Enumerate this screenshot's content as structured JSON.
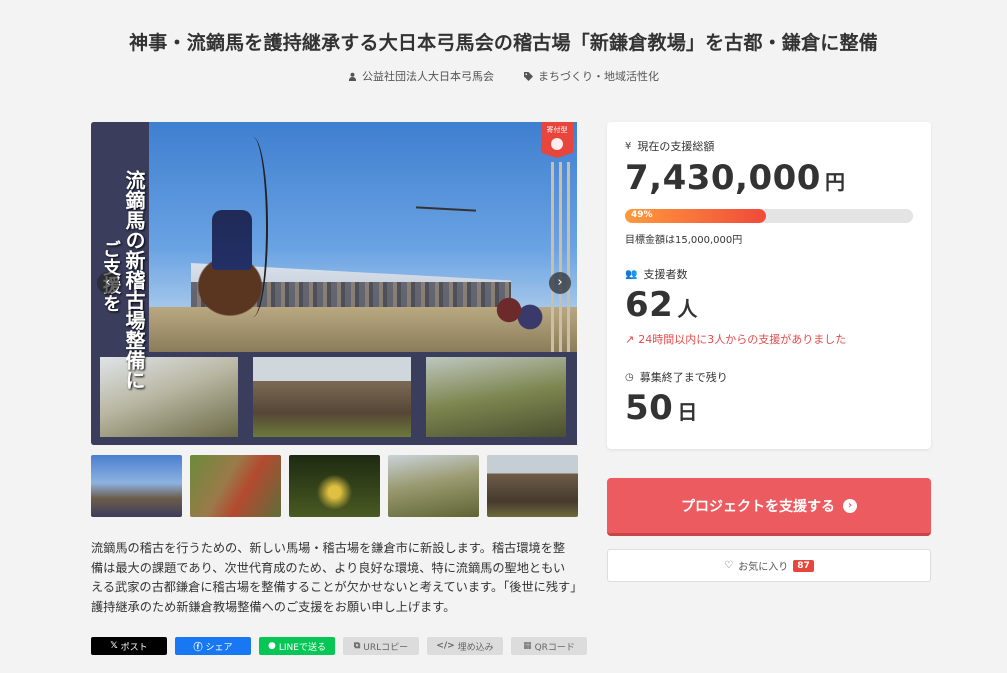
{
  "project": {
    "title": "神事・流鏑馬を護持継承する大日本弓馬会の稽古場「新鎌倉教場」を古都・鎌倉に整備",
    "owner": "公益社団法人大日本弓馬会",
    "category": "まちづくり・地域活性化"
  },
  "hero": {
    "vertical_text_1": "流鏑馬の新稽古場整備に",
    "vertical_text_2": "ご支援を",
    "badge_label": "寄付型",
    "thumbnails": [
      "thumb-1",
      "thumb-2",
      "thumb-3",
      "thumb-4",
      "thumb-5"
    ]
  },
  "description": "流鏑馬の稽古を行うための、新しい馬場・稽古場を鎌倉市に新設します。稽古環境を整備は最大の課題であり、次世代育成のため、より良好な環境、特に流鏑馬の聖地ともいえる武家の古都鎌倉に稽古場を整備することが欠かせないと考えています。「後世に残す」護持継承のため新鎌倉教場整備へのご支援をお願い申し上げます。",
  "share": {
    "x": "ポスト",
    "facebook": "シェア",
    "line": "LINEで送る",
    "url_copy": "URLコピー",
    "embed": "埋め込み",
    "qr": "QRコード"
  },
  "stats": {
    "total_label": "現在の支援総額",
    "total_amount": "7,430,000",
    "total_unit": "円",
    "progress_label": "49%",
    "progress_fraction": 0.49,
    "goal_text": "目標金額は15,000,000円",
    "supporters_label": "支援者数",
    "supporters_count": "62",
    "supporters_unit": "人",
    "trend_text": "24時間以内に3人からの支援がありました",
    "remaining_label": "募集終了まで残り",
    "remaining_days": "50",
    "remaining_unit": "日"
  },
  "actions": {
    "support_label": "プロジェクトを支援する",
    "favorite_label": "お気に入り",
    "favorite_count": "87"
  },
  "colors": {
    "accent": "#ec5b5f",
    "trend": "#e84a4a",
    "badge": "#e8453c"
  }
}
